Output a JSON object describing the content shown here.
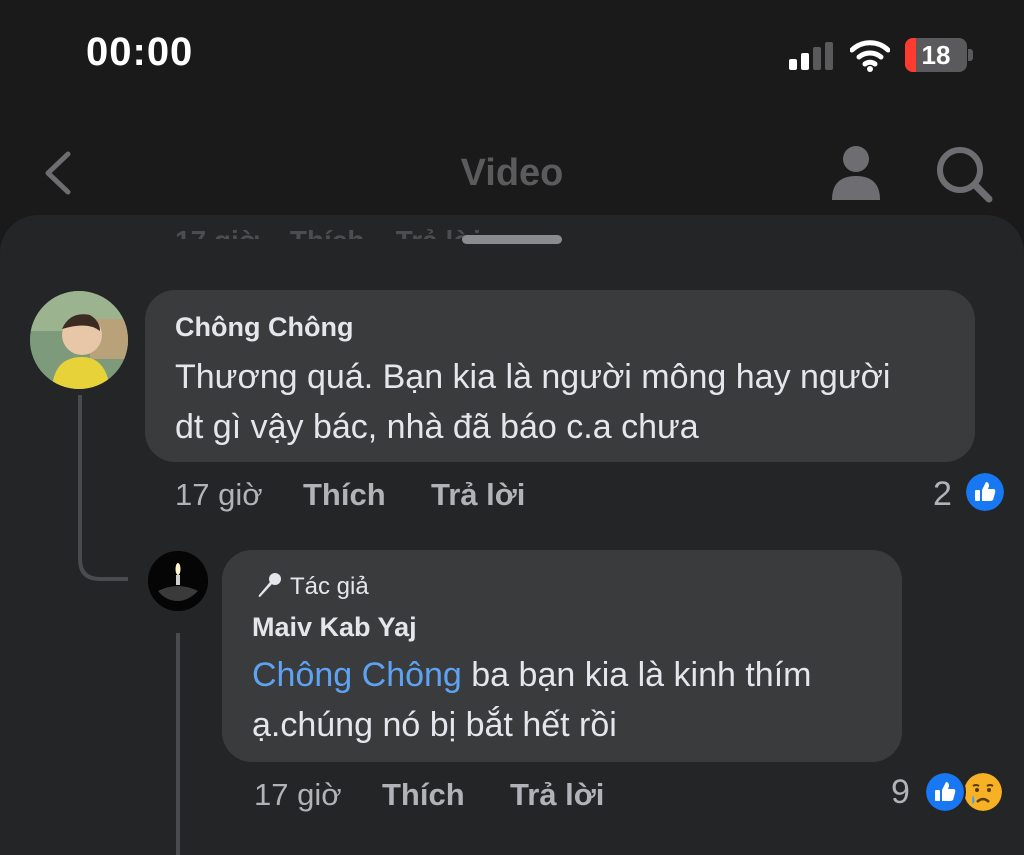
{
  "status": {
    "time": "00:00",
    "battery": "18",
    "battery_level": 0.18
  },
  "nav": {
    "title": "Video",
    "back_icon": "chevron-left-icon",
    "profile_icon": "person-icon",
    "search_icon": "search-icon"
  },
  "comments": [
    {
      "author": "Chông Chông",
      "text_lines": [
        "Thương quá. Bạn kia là người mông hay người",
        "dt gì vậy bác, nhà đã báo c.a chưa"
      ],
      "time": "17 giờ",
      "like_label": "Thích",
      "reply_label": "Trả lời",
      "reaction_count": "2",
      "reactions": [
        "like-icon"
      ]
    },
    {
      "author_tag": "Tác giả",
      "author": "Maiv Kab Yaj",
      "mention": "Chông Chông",
      "text_line1_rest": " ba bạn kia là kinh thím",
      "text_line2": "ạ.chúng nó bị bắt hết rồi",
      "time": "17 giờ",
      "like_label": "Thích",
      "reply_label": "Trả lời",
      "reaction_count": "9",
      "reactions": [
        "like-icon",
        "sad-cry-icon"
      ]
    }
  ],
  "colors": {
    "background": "#1a1a1b",
    "sheet": "#242526",
    "bubble": "#3a3b3c",
    "mention": "#5ea3f3",
    "like": "#1877f2"
  }
}
